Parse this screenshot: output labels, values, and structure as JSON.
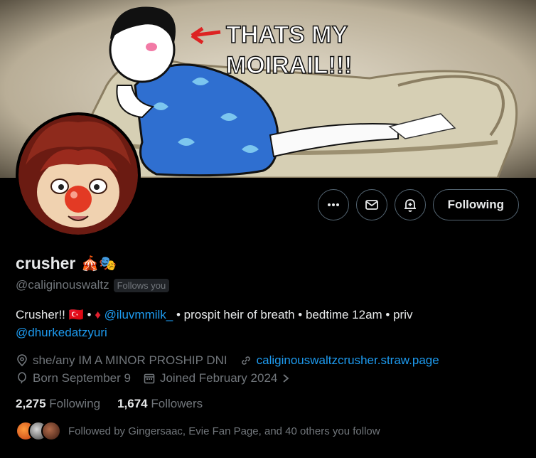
{
  "banner": {
    "caption_line1": "THATS MY",
    "caption_line2": "MOIRAIL!!!"
  },
  "actions": {
    "more_icon": "more-horizontal-icon",
    "message_icon": "envelope-icon",
    "notify_icon": "bell-plus-icon",
    "following_label": "Following"
  },
  "profile": {
    "display_name": "crusher",
    "name_emoji": "🎪🎭",
    "handle": "@caliginouswaltz",
    "follows_you": "Follows you"
  },
  "bio": {
    "part1": "Crusher!! ",
    "flag": "🇹🇷",
    "part2": " • ",
    "diamond": "♦",
    "mention1": "@iluvmmilk_",
    "part3": " • prospit heir of breath • bedtime 12am • priv",
    "mention2": "@dhurkedatzyuri"
  },
  "meta": {
    "location": "she/any IM A MINOR PROSHIP DNI",
    "website": "caliginouswaltzcrusher.straw.page",
    "birthday": "Born September 9",
    "joined": "Joined February 2024"
  },
  "counts": {
    "following_count": "2,275",
    "following_label": "Following",
    "followers_count": "1,674",
    "followers_label": "Followers"
  },
  "followed_by": "Followed by Gingersaac, Evie Fan Page, and 40 others you follow",
  "colors": {
    "accent": "#1d9bf0",
    "muted": "#71767b",
    "text": "#e7e9ea",
    "border": "#536471"
  }
}
